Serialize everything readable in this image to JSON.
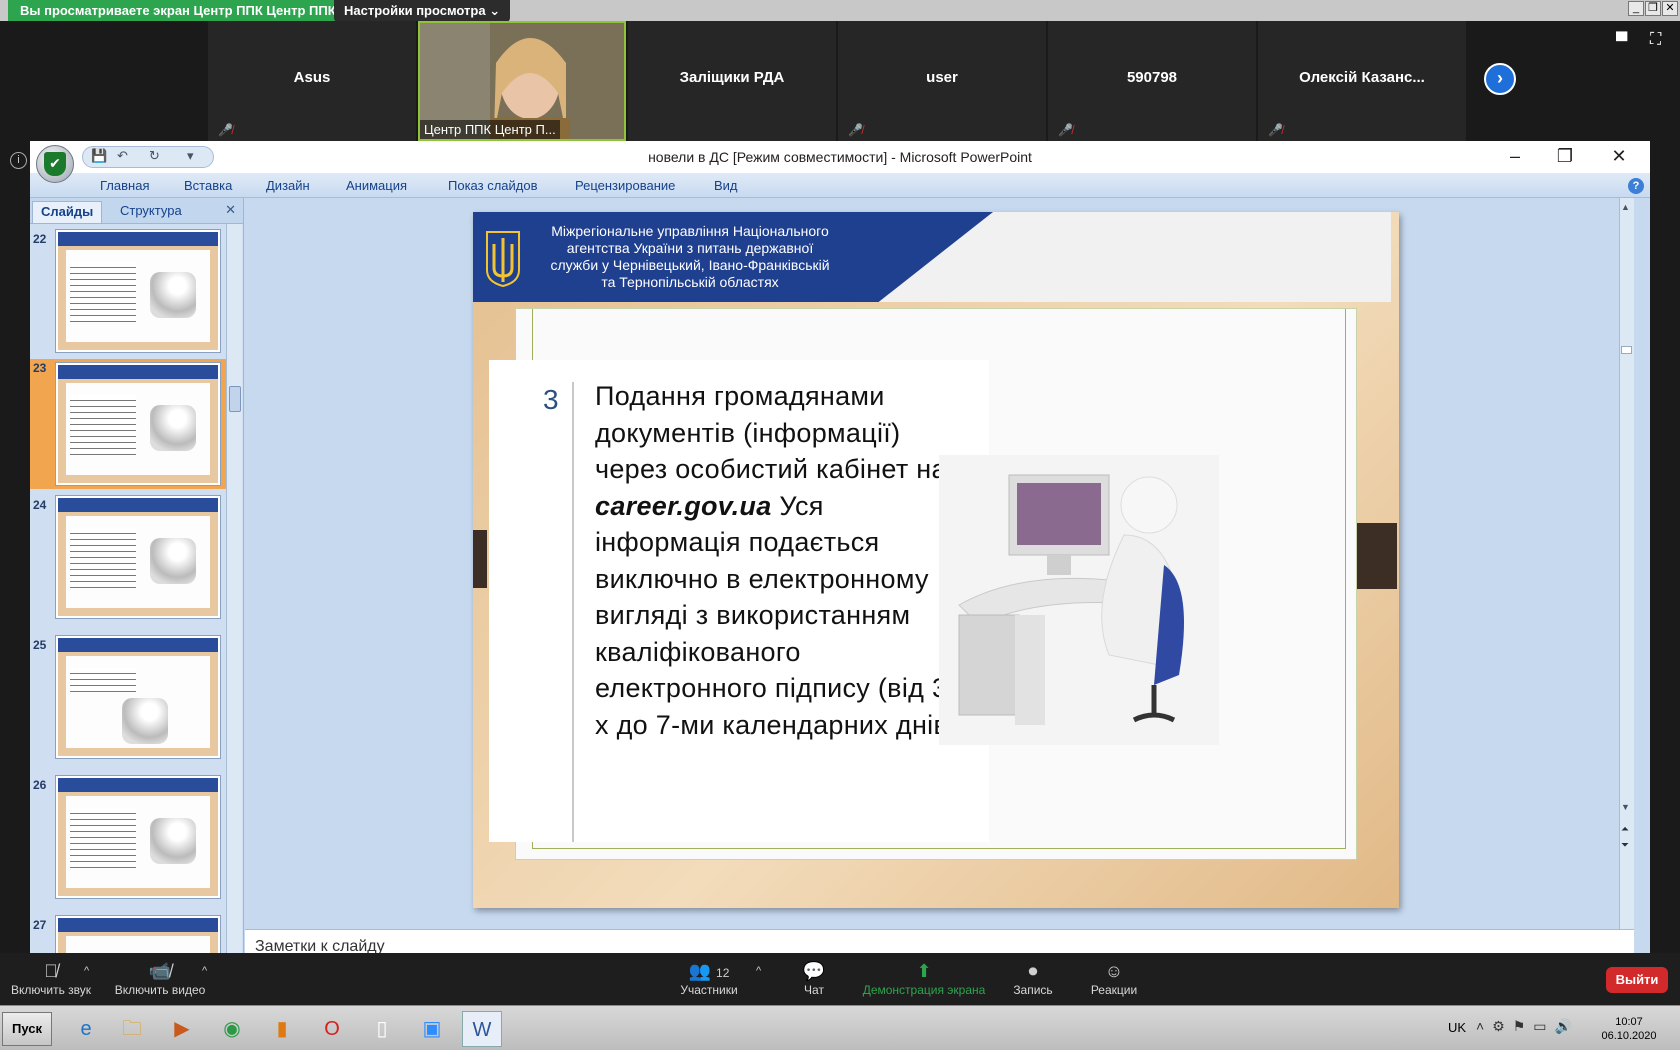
{
  "zoom": {
    "share_banner": "Вы просматриваете экран Центр ППК Центр ППК",
    "view_options": "Настройки просмотра ⌄",
    "participants": [
      {
        "name": "Asus"
      },
      {
        "name": "Центр ППК Центр П..."
      },
      {
        "name": "Заліщики РДА"
      },
      {
        "name": "user"
      },
      {
        "name": "590798"
      },
      {
        "name": "Олексій Казанс..."
      }
    ],
    "toolbar": {
      "mute": "Включить звук",
      "video": "Включить видео",
      "participants_label": "Участники",
      "participants_count": "12",
      "chat": "Чат",
      "share": "Демонстрация экрана",
      "record": "Запись",
      "reactions": "Реакции",
      "leave": "Выйти"
    }
  },
  "ppt": {
    "title": "новели в ДС [Режим совместимости] - Microsoft PowerPoint",
    "ribbon_tabs": [
      "Главная",
      "Вставка",
      "Дизайн",
      "Анимация",
      "Показ слайдов",
      "Рецензирование",
      "Вид"
    ],
    "pane_tabs": {
      "slides": "Слайды",
      "outline": "Структура"
    },
    "thumbnails": [
      "22",
      "23",
      "24",
      "25",
      "26",
      "27"
    ],
    "selected_slide": "23",
    "notes_placeholder": "Заметки к слайду"
  },
  "slide": {
    "header_text": "Міжрегіональне управління Національного агентства України з питань державної служби у Чернівецький, Івано-Франківській та Тернопільській областях",
    "number": "3",
    "text_before": "Подання громадянами документів (інформації) через особистий кабінет на ",
    "text_link": "career.gov.ua",
    "text_after": " Уся інформація подається виключно в електронному вигляді з використанням кваліфікованого електронного підпису (від 3-х до 7-ми календарних днів)"
  },
  "taskbar": {
    "start": "Пуск",
    "lang": "UK",
    "time": "10:07",
    "date": "06.10.2020"
  },
  "colors": {
    "zoom_green": "#2da44e",
    "header_blue": "#1f3f8f",
    "leave_red": "#d22a2a",
    "selected_thumb": "#f1a54e"
  }
}
